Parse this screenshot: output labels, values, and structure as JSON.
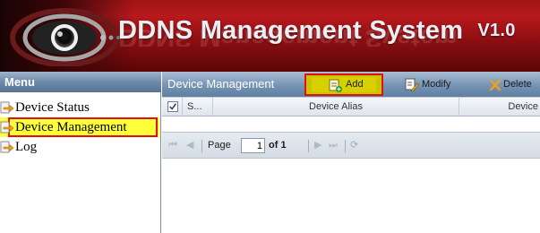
{
  "app": {
    "title": "DDNS Management System",
    "version": "V1.0"
  },
  "menu": {
    "header": "Menu",
    "items": [
      {
        "label": "Device Status",
        "icon": "folder-arrow-icon",
        "active": false
      },
      {
        "label": "Device Management",
        "icon": "folder-arrow-icon",
        "active": true
      },
      {
        "label": "Log",
        "icon": "folder-arrow-icon",
        "active": false
      }
    ]
  },
  "panel": {
    "title": "Device Management",
    "toolbar": {
      "add_label": "Add",
      "modify_label": "Modify",
      "delete_label": "Delete"
    },
    "grid": {
      "columns": [
        "S...",
        "Device Alias",
        "Device"
      ]
    },
    "pager": {
      "first": "⏮",
      "prev": "◀",
      "page_label": "Page",
      "current_page": "1",
      "of_label": "of 1",
      "next": "▶",
      "last": "⏭",
      "refresh": "⟳"
    }
  },
  "colors": {
    "banner_red": "#a01416",
    "highlight_yellow": "#ffff3a",
    "annotation_red": "#e01010",
    "header_blue": "#6f8aa9"
  }
}
